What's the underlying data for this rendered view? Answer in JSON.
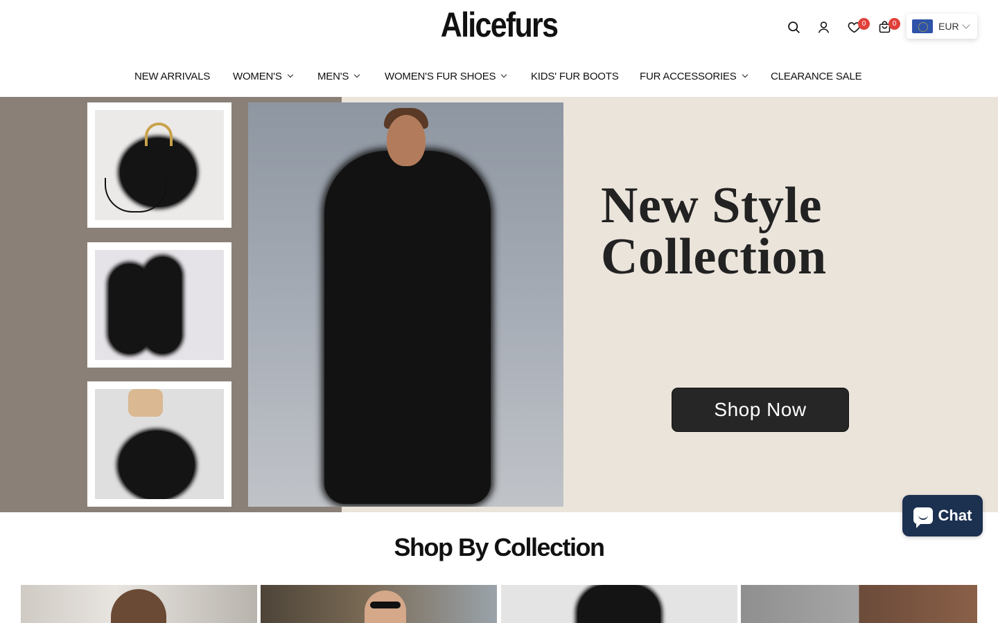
{
  "brand": {
    "logo": "Alicefurs"
  },
  "header": {
    "icons": [
      "search-icon",
      "account-icon",
      "wishlist-icon",
      "cart-icon"
    ],
    "wishlist_count": "0",
    "cart_count": "0",
    "currency": "EUR"
  },
  "nav": {
    "items": [
      {
        "label": "NEW ARRIVALS",
        "has_dropdown": false
      },
      {
        "label": "WOMEN'S",
        "has_dropdown": true
      },
      {
        "label": "MEN'S",
        "has_dropdown": true
      },
      {
        "label": "WOMEN'S FUR SHOES",
        "has_dropdown": true
      },
      {
        "label": "KIDS' FUR BOOTS",
        "has_dropdown": false
      },
      {
        "label": "FUR ACCESSORIES",
        "has_dropdown": true
      },
      {
        "label": "CLEARANCE SALE",
        "has_dropdown": false
      }
    ]
  },
  "hero": {
    "title_line1": "New Style",
    "title_line2": "Collection",
    "cta": "Shop Now"
  },
  "chat": {
    "label": "Chat"
  },
  "collection": {
    "title": "Shop By Collection"
  },
  "colors": {
    "accent": "#e0413a",
    "chat_bg": "#1c3050",
    "hero_bg": "#ebe4db",
    "hero_left": "#8b8077"
  }
}
